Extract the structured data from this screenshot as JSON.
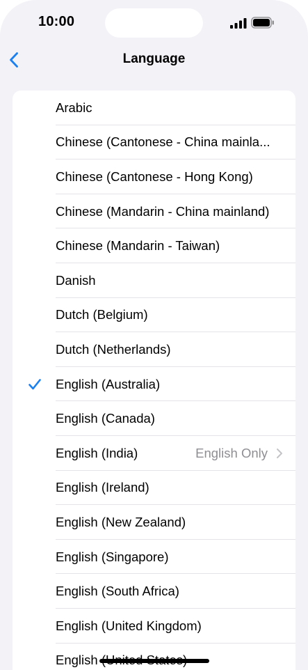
{
  "status_bar": {
    "time": "10:00"
  },
  "nav": {
    "title": "Language"
  },
  "colors": {
    "accent": "#1a7ff0",
    "detail": "#8e8e93",
    "background": "#f2f2f7"
  },
  "icons": {
    "back": "chevron-left-icon",
    "check": "checkmark-icon",
    "disclosure": "chevron-right-icon"
  },
  "languages": [
    {
      "label": "Arabic"
    },
    {
      "label": "Chinese (Cantonese - China mainla..."
    },
    {
      "label": "Chinese (Cantonese - Hong Kong)"
    },
    {
      "label": "Chinese (Mandarin - China mainland)"
    },
    {
      "label": "Chinese (Mandarin - Taiwan)"
    },
    {
      "label": "Danish"
    },
    {
      "label": "Dutch (Belgium)"
    },
    {
      "label": "Dutch (Netherlands)"
    },
    {
      "label": "English (Australia)",
      "selected": true
    },
    {
      "label": "English (Canada)"
    },
    {
      "label": "English (India)",
      "detail": "English Only"
    },
    {
      "label": "English (Ireland)"
    },
    {
      "label": "English (New Zealand)"
    },
    {
      "label": "English (Singapore)"
    },
    {
      "label": "English (South Africa)"
    },
    {
      "label": "English (United Kingdom)"
    },
    {
      "label": "English (United States)"
    }
  ]
}
